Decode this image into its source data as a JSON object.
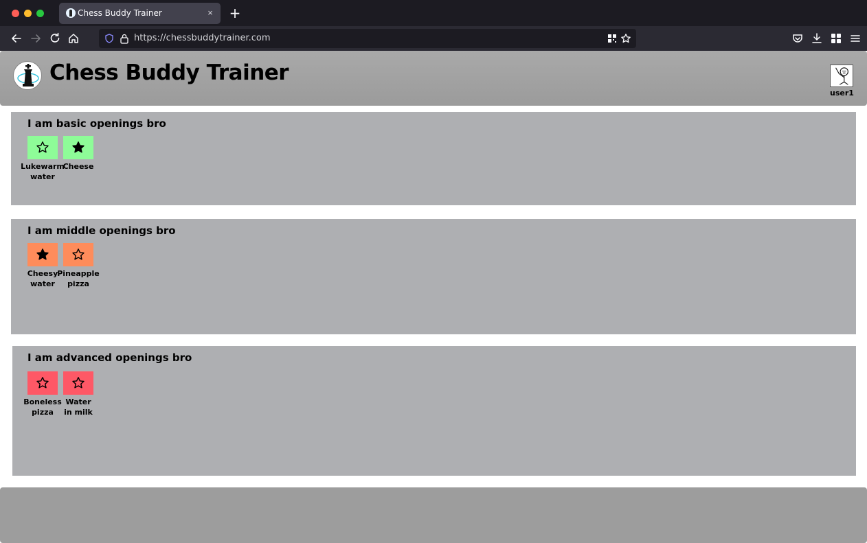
{
  "browser": {
    "tab_title": "Chess Buddy Trainer",
    "close_glyph": "×",
    "newtab_glyph": "+",
    "url": "https://chessbuddytrainer.com"
  },
  "app": {
    "title": "Chess Buddy Trainer",
    "username": "user1"
  },
  "sections": [
    {
      "title": "I am basic openings bro",
      "color": "#8efc98",
      "openings": [
        {
          "label_line1": "Lukewarm",
          "label_line2": "water",
          "starred": false
        },
        {
          "label_line1": "Cheese",
          "label_line2": "",
          "starred": true
        }
      ]
    },
    {
      "title": "I am middle openings bro",
      "color": "#fe8c5b",
      "openings": [
        {
          "label_line1": "Cheesy",
          "label_line2": "water",
          "starred": true
        },
        {
          "label_line1": "Pineapple",
          "label_line2": "pizza",
          "starred": false
        }
      ]
    },
    {
      "title": "I am advanced openings bro",
      "color": "#fe5866",
      "openings": [
        {
          "label_line1": "Boneless",
          "label_line2": "pizza",
          "starred": false
        },
        {
          "label_line1": "Water",
          "label_line2": "in milk",
          "starred": false
        }
      ]
    }
  ]
}
